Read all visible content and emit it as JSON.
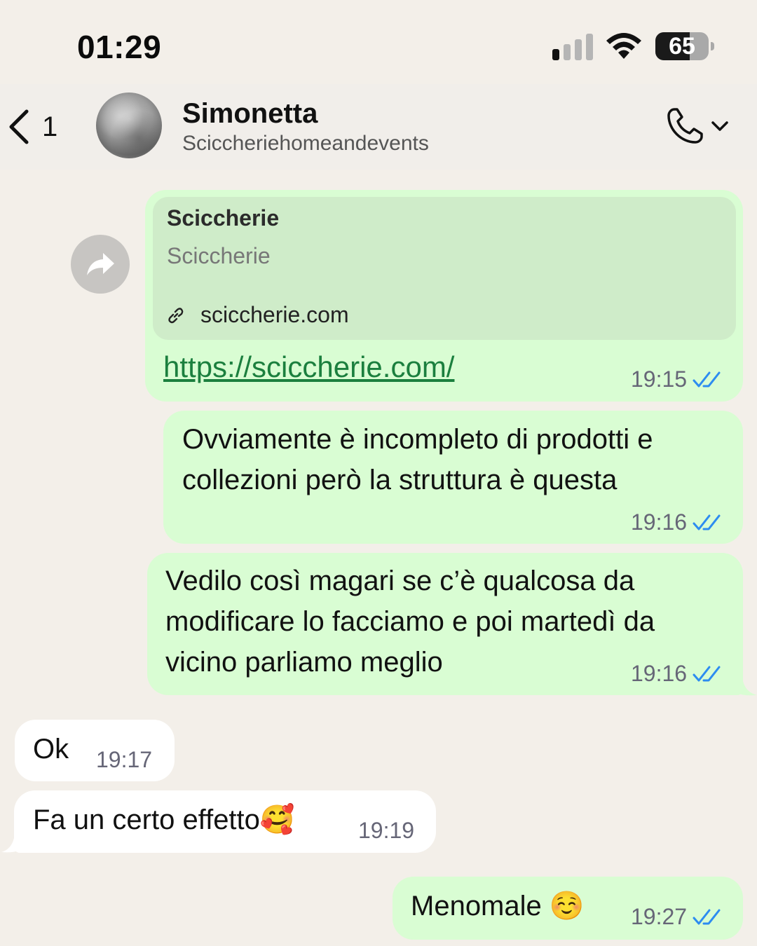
{
  "status_bar": {
    "time": "01:29",
    "battery": "65",
    "battery_level_percent": 65,
    "signal_bars_active": 1,
    "signal_bars_total": 4
  },
  "header": {
    "back_count": "1",
    "contact_name": "Simonetta",
    "contact_subtitle": "Sciccheriehomeandevents"
  },
  "messages": [
    {
      "direction": "outgoing",
      "preview_title": "Sciccherie",
      "preview_description": "Sciccherie",
      "preview_domain": "sciccherie.com",
      "text": "https://sciccherie.com/",
      "time": "19:15",
      "status": "read"
    },
    {
      "direction": "outgoing",
      "text_line1": "Ovviamente è incompleto di prodotti e",
      "text_line2": "collezioni però la struttura è questa",
      "time": "19:16",
      "status": "read"
    },
    {
      "direction": "outgoing",
      "text_line1": "Vedilo così magari se c’è qualcosa da",
      "text_line2": "modificare lo facciamo e poi martedì da",
      "text_line3": "vicino parliamo meglio",
      "time": "19:16",
      "status": "read"
    },
    {
      "direction": "incoming",
      "text": "Ok",
      "time": "19:17"
    },
    {
      "direction": "incoming",
      "text": "Fa un certo effetto🥰",
      "time": "19:19"
    },
    {
      "direction": "outgoing",
      "text": "Menomale ☺️",
      "time": "19:27",
      "status": "read"
    }
  ],
  "colors": {
    "chat_background": "#f3efe9",
    "outgoing_bubble": "#d9fdd3",
    "incoming_bubble": "#ffffff",
    "link_preview": "#cfecc9",
    "link": "#1b7f3e",
    "read_ticks": "#2d8cf0"
  },
  "icons": [
    "back-chevron-icon",
    "avatar",
    "phone-icon",
    "chevron-down-icon",
    "forward-icon",
    "link-icon",
    "double-check-icon",
    "signal-icon",
    "wifi-icon",
    "battery-icon"
  ]
}
